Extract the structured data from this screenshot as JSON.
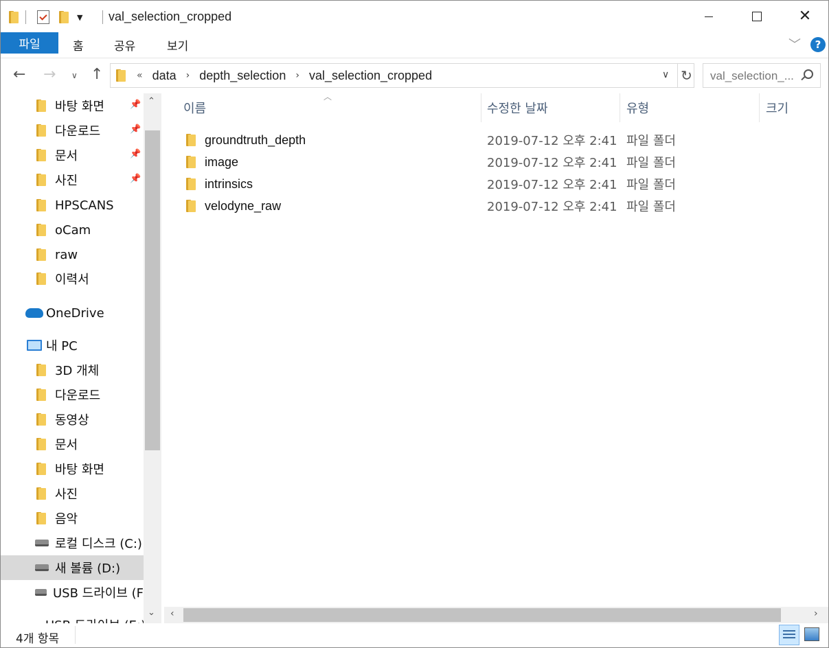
{
  "window": {
    "title": "val_selection_cropped"
  },
  "ribbon": {
    "file_tab": "파일",
    "tabs": [
      "홈",
      "공유",
      "보기"
    ],
    "help": "?"
  },
  "address": {
    "overflow": "«",
    "crumbs": [
      "data",
      "depth_selection",
      "val_selection_cropped"
    ],
    "search_placeholder": "val_selection_..."
  },
  "sidebar": {
    "quick_access": [
      {
        "label": "바탕 화면",
        "pinned": true
      },
      {
        "label": "다운로드",
        "pinned": true
      },
      {
        "label": "문서",
        "pinned": true
      },
      {
        "label": "사진",
        "pinned": true
      },
      {
        "label": "HPSCANS",
        "pinned": false
      },
      {
        "label": "oCam",
        "pinned": false
      },
      {
        "label": "raw",
        "pinned": false
      },
      {
        "label": "이력서",
        "pinned": false
      }
    ],
    "onedrive": "OneDrive",
    "this_pc": "내 PC",
    "pc_items": [
      "3D 개체",
      "다운로드",
      "동영상",
      "문서",
      "바탕 화면",
      "사진",
      "음악"
    ],
    "drives": [
      "로컬 디스크 (C:)",
      "새 볼륨 (D:)",
      "USB 드라이브 (F",
      "USB 드라이브 (E:)"
    ],
    "selected_drive": "새 볼륨 (D:)"
  },
  "columns": {
    "name": "이름",
    "date": "수정한 날짜",
    "type": "유형",
    "size": "크기"
  },
  "files": [
    {
      "name": "groundtruth_depth",
      "date": "2019-07-12 오후 2:41",
      "type": "파일 폴더"
    },
    {
      "name": "image",
      "date": "2019-07-12 오후 2:41",
      "type": "파일 폴더"
    },
    {
      "name": "intrinsics",
      "date": "2019-07-12 오후 2:41",
      "type": "파일 폴더"
    },
    {
      "name": "velodyne_raw",
      "date": "2019-07-12 오후 2:41",
      "type": "파일 폴더"
    }
  ],
  "status": {
    "item_count": "4개 항목"
  },
  "colors": {
    "accent": "#1979ca",
    "folder": "#f5cc5a",
    "selected_bg": "#d9d9d9",
    "header_text": "#4c607a"
  }
}
